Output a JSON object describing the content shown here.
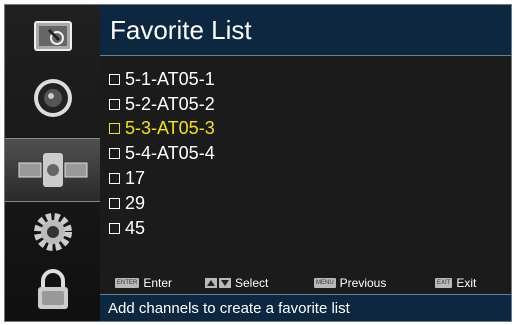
{
  "title": "Favorite List",
  "channels": [
    {
      "label": "5-1-AT05-1",
      "selected": false
    },
    {
      "label": "5-2-AT05-2",
      "selected": false
    },
    {
      "label": "5-3-AT05-3",
      "selected": true
    },
    {
      "label": "5-4-AT05-4",
      "selected": false
    },
    {
      "label": "17",
      "selected": false
    },
    {
      "label": "29",
      "selected": false
    },
    {
      "label": "45",
      "selected": false
    }
  ],
  "hints": {
    "enter_key": "ENTER",
    "enter": "Enter",
    "select": "Select",
    "menu_key": "MENU",
    "previous": "Previous",
    "exit_key": "EXIT",
    "exit": "Exit"
  },
  "status": "Add channels to create a favorite list",
  "sidebar": {
    "items": [
      {
        "icon": "picture-icon"
      },
      {
        "icon": "sound-icon"
      },
      {
        "icon": "channel-satellite-icon",
        "active": true
      },
      {
        "icon": "settings-gear-icon"
      },
      {
        "icon": "lock-icon"
      }
    ]
  },
  "colors": {
    "header_bg": "#0e2740",
    "selected_text": "#f4e20d",
    "panel_bg": "#1b1b1b"
  }
}
